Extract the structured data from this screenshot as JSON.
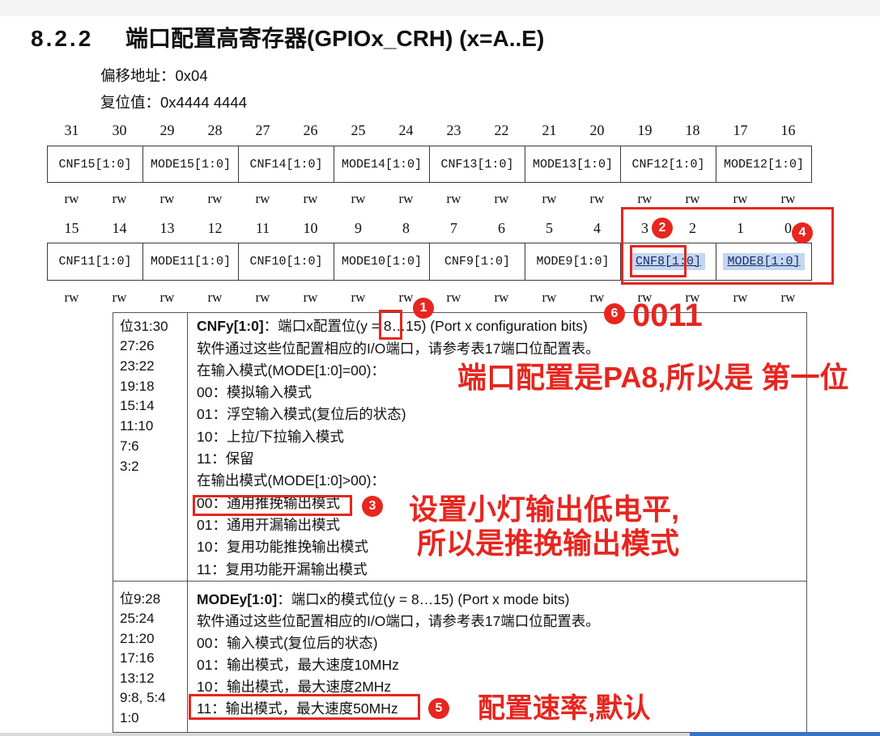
{
  "section": {
    "number": "8.2.2",
    "title": "端口配置高寄存器(GPIOx_CRH) (x=A..E)"
  },
  "register_info": {
    "offset": "偏移地址：0x04",
    "reset_value": "复位值：0x4444 4444"
  },
  "register": {
    "upper": {
      "bits": [
        "31",
        "30",
        "29",
        "28",
        "27",
        "26",
        "25",
        "24",
        "23",
        "22",
        "21",
        "20",
        "19",
        "18",
        "17",
        "16"
      ],
      "fields": [
        "CNF15[1:0]",
        "MODE15[1:0]",
        "CNF14[1:0]",
        "MODE14[1:0]",
        "CNF13[1:0]",
        "MODE13[1:0]",
        "CNF12[1:0]",
        "MODE12[1:0]"
      ],
      "access": [
        "rw",
        "rw",
        "rw",
        "rw",
        "rw",
        "rw",
        "rw",
        "rw",
        "rw",
        "rw",
        "rw",
        "rw",
        "rw",
        "rw",
        "rw",
        "rw"
      ],
      "highlighted": []
    },
    "lower": {
      "bits": [
        "15",
        "14",
        "13",
        "12",
        "11",
        "10",
        "9",
        "8",
        "7",
        "6",
        "5",
        "4",
        "3",
        "2",
        "1",
        "0"
      ],
      "fields": [
        "CNF11[1:0]",
        "MODE11[1:0]",
        "CNF10[1:0]",
        "MODE10[1:0]",
        "CNF9[1:0]",
        "MODE9[1:0]",
        "CNF8[1:0]",
        "MODE8[1:0]"
      ],
      "access": [
        "rw",
        "rw",
        "rw",
        "rw",
        "rw",
        "rw",
        "rw",
        "rw",
        "rw",
        "rw",
        "rw",
        "rw",
        "rw",
        "rw",
        "rw",
        "rw"
      ],
      "highlighted": [
        6,
        7
      ]
    }
  },
  "descriptions": [
    {
      "bit_ranges": [
        "位31:30",
        "27:26",
        "23:22",
        "19:18",
        "15:14",
        "11:10",
        "7:6",
        "3:2"
      ],
      "name": "CNFy[1:0]",
      "heading": "：端口x配置位(y = 8…15) (Port x configuration bits)",
      "lines": [
        "软件通过这些位配置相应的I/O端口，请参考表17端口位配置表。",
        "在输入模式(MODE[1:0]=00)：",
        "00：模拟输入模式",
        "01：浮空输入模式(复位后的状态)",
        "10：上拉/下拉输入模式",
        "11：保留",
        "在输出模式(MODE[1:0]>00)：",
        "00：通用推挽输出模式",
        "01：通用开漏输出模式",
        "10：复用功能推挽输出模式",
        "11：复用功能开漏输出模式"
      ]
    },
    {
      "bit_ranges": [
        "位9:28",
        "25:24",
        "21:20",
        "17:16",
        "13:12",
        "9:8, 5:4",
        "1:0"
      ],
      "name": "MODEy[1:0]",
      "heading": "：端口x的模式位(y = 8…15) (Port x mode bits)",
      "lines": [
        "软件通过这些位配置相应的I/O端口，请参考表17端口位配置表。",
        "00：输入模式(复位后的状态)",
        "01：输出模式，最大速度10MHz",
        "10：输出模式，最大速度2MHz",
        "11：输出模式，最大速度50MHz"
      ]
    }
  ],
  "annotations": {
    "badges": [
      "1",
      "2",
      "3",
      "4",
      "5",
      "6"
    ],
    "value_label": "0011",
    "note_pin": "端口配置是PA8,所以是 第一位",
    "note_mode_line1": "设置小灯输出低电平,",
    "note_mode_line2": "所以是推挽输出模式",
    "note_speed": "配置速率,默认"
  },
  "colors": {
    "annotation": "#e6261f",
    "selection": "#c3d7f2",
    "text": "#111111"
  }
}
